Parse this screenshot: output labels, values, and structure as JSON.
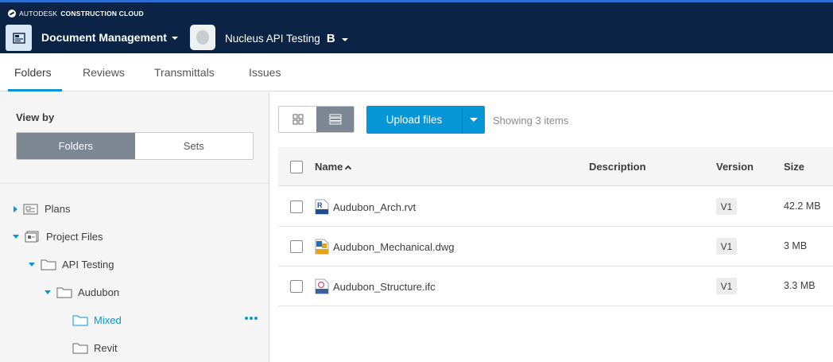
{
  "brand": {
    "prefix": "AUTODESK",
    "product": "CONSTRUCTION CLOUD"
  },
  "header": {
    "module": "Document Management",
    "project": "Nucleus API Testing",
    "project_mark": "B"
  },
  "tabs": [
    {
      "label": "Folders",
      "active": true
    },
    {
      "label": "Reviews",
      "active": false
    },
    {
      "label": "Transmittals",
      "active": false
    },
    {
      "label": "Issues",
      "active": false
    }
  ],
  "sidebar": {
    "view_by_label": "View by",
    "segments": [
      "Folders",
      "Sets"
    ],
    "tree": [
      {
        "label": "Plans",
        "expanded": false,
        "level": 0,
        "icon": "plans-icon"
      },
      {
        "label": "Project Files",
        "expanded": true,
        "level": 0,
        "icon": "project-files-icon"
      },
      {
        "label": "API Testing",
        "expanded": true,
        "level": 1,
        "icon": "folder-icon"
      },
      {
        "label": "Audubon",
        "expanded": true,
        "level": 2,
        "icon": "folder-icon"
      },
      {
        "label": "Mixed",
        "selected": true,
        "level": 3,
        "icon": "folder-icon"
      },
      {
        "label": "Revit",
        "level": 3,
        "icon": "folder-icon"
      }
    ]
  },
  "toolbar": {
    "upload_label": "Upload files",
    "showing": "Showing 3 items",
    "view_mode": "list"
  },
  "table": {
    "columns": [
      "Name",
      "Description",
      "Version",
      "Size"
    ],
    "rows": [
      {
        "name": "Audubon_Arch.rvt",
        "description": "",
        "version": "V1",
        "size": "42.2 MB",
        "icon": "rvt-file-icon"
      },
      {
        "name": "Audubon_Mechanical.dwg",
        "description": "",
        "version": "V1",
        "size": "3 MB",
        "icon": "dwg-file-icon"
      },
      {
        "name": "Audubon_Structure.ifc",
        "description": "",
        "version": "V1",
        "size": "3.3 MB",
        "icon": "ifc-file-icon"
      }
    ]
  },
  "colors": {
    "header_bg": "#0b2445",
    "accent": "#0696d7",
    "segment_active": "#7c8793"
  }
}
